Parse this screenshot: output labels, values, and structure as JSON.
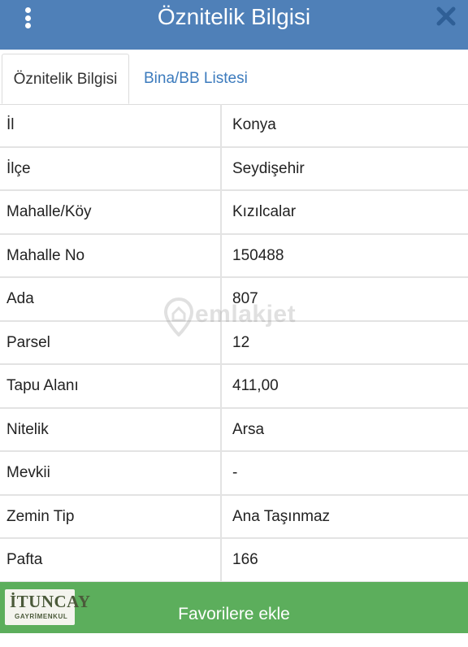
{
  "header": {
    "title": "Öznitelik Bilgisi"
  },
  "tabs": [
    {
      "label": "Öznitelik Bilgisi",
      "active": true
    },
    {
      "label": "Bina/BB Listesi",
      "active": false
    }
  ],
  "rows": [
    {
      "label": "İl",
      "value": "Konya"
    },
    {
      "label": "İlçe",
      "value": "Seydişehir"
    },
    {
      "label": "Mahalle/Köy",
      "value": "Kızılcalar"
    },
    {
      "label": "Mahalle No",
      "value": "150488"
    },
    {
      "label": "Ada",
      "value": "807"
    },
    {
      "label": "Parsel",
      "value": "12"
    },
    {
      "label": "Tapu Alanı",
      "value": "411,00"
    },
    {
      "label": "Nitelik",
      "value": "Arsa"
    },
    {
      "label": "Mevkii",
      "value": "-"
    },
    {
      "label": "Zemin Tip",
      "value": "Ana Taşınmaz"
    },
    {
      "label": "Pafta",
      "value": "166"
    }
  ],
  "watermark": "emlakjet",
  "footer": {
    "button_label": "Favorilere ekle",
    "logo_main": "İTUNCAY",
    "logo_sub": "GAYRİMENKUL"
  },
  "colors": {
    "header_bg": "#4f80b8",
    "tab_link": "#3c7bbd",
    "footer_bg": "#5cae5c"
  }
}
